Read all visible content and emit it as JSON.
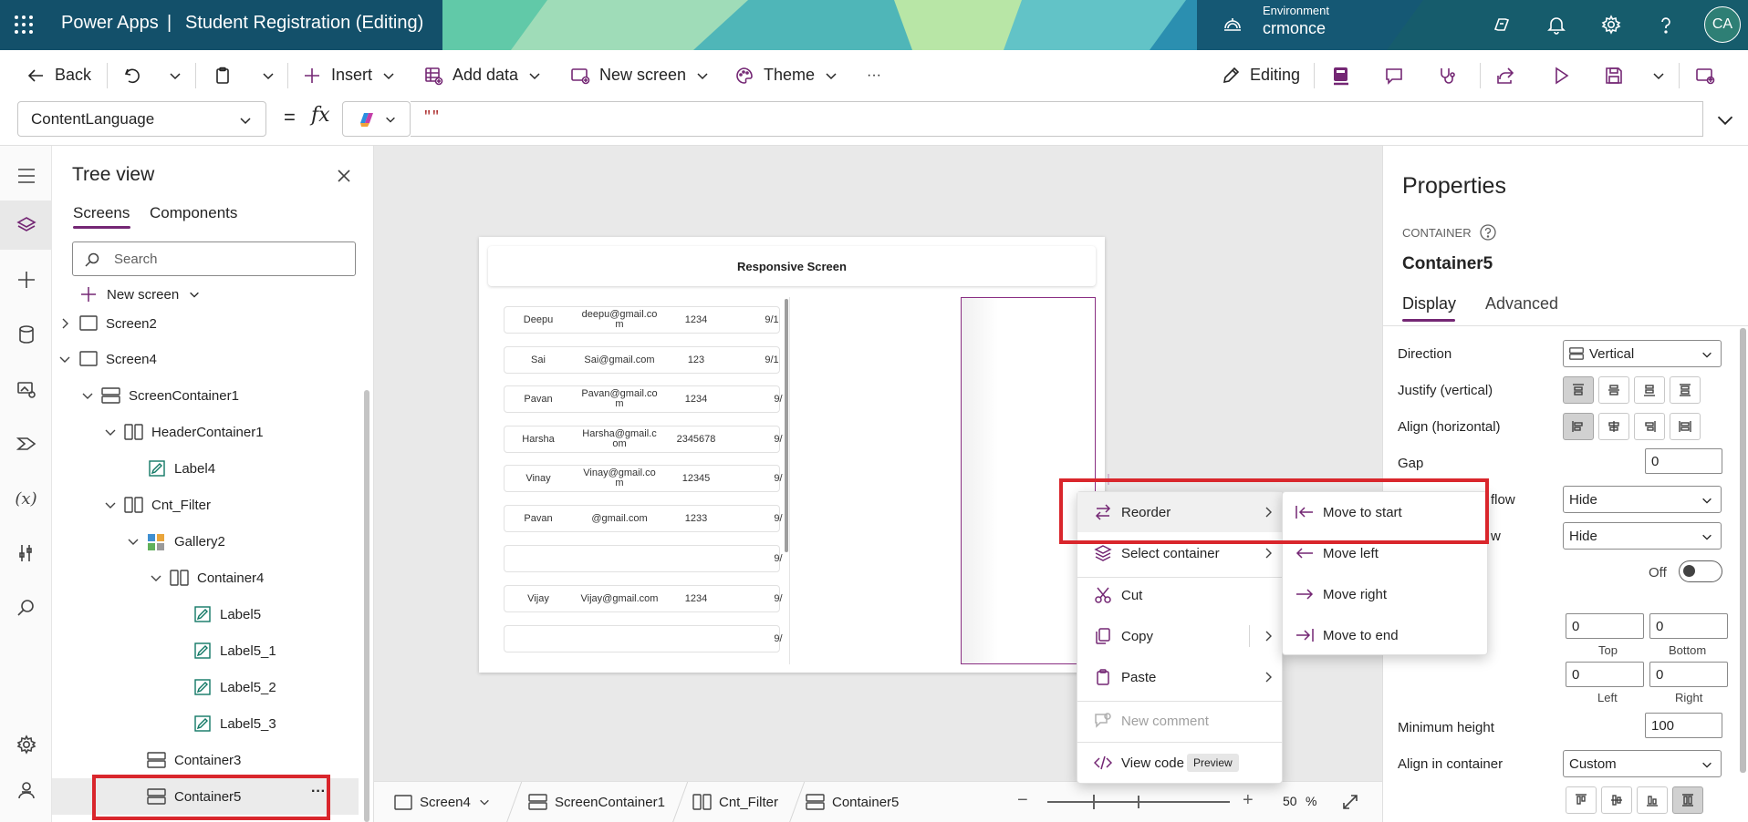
{
  "header": {
    "app_name": "Power Apps",
    "separator": "|",
    "app_title": "Student Registration (Editing)",
    "environment_label": "Environment",
    "environment_name": "crmonce",
    "avatar_initials": "CA"
  },
  "cmdbar": {
    "back": "Back",
    "insert": "Insert",
    "add_data": "Add data",
    "new_screen": "New screen",
    "theme": "Theme",
    "more": "···",
    "editing": "Editing"
  },
  "formula": {
    "property": "ContentLanguage",
    "equals": "=",
    "fx": "fx",
    "value": "\"\""
  },
  "tree": {
    "title": "Tree view",
    "tabs": [
      "Screens",
      "Components"
    ],
    "search_placeholder": "Search",
    "new_screen": "New screen",
    "items": [
      "Screen2",
      "Screen4",
      "ScreenContainer1",
      "HeaderContainer1",
      "Label4",
      "Cnt_Filter",
      "Gallery2",
      "Container4",
      "Label5",
      "Label5_1",
      "Label5_2",
      "Label5_3",
      "Container3",
      "Container5"
    ],
    "more": "···"
  },
  "canvas": {
    "header_title": "Responsive Screen",
    "rows": [
      {
        "name": "Deepu",
        "email": "deepu@gmail.co m",
        "phone": "1234",
        "date": "9/1"
      },
      {
        "name": "Sai",
        "email": "Sai@gmail.com",
        "phone": "123",
        "date": "9/1"
      },
      {
        "name": "Pavan",
        "email": "Pavan@gmail.co m",
        "phone": "1234",
        "date": "9/"
      },
      {
        "name": "Harsha",
        "email": "Harsha@gmail.c om",
        "phone": "2345678",
        "date": "9/"
      },
      {
        "name": "Vinay",
        "email": "Vinay@gmail.co m",
        "phone": "12345",
        "date": "9/"
      },
      {
        "name": "Pavan",
        "email": "@gmail.com",
        "phone": "1233",
        "date": "9/"
      },
      {
        "name": "",
        "email": "",
        "phone": "",
        "date": "9/"
      },
      {
        "name": "Vijay",
        "email": "Vijay@gmail.com",
        "phone": "1234",
        "date": "9/"
      },
      {
        "name": "",
        "email": "",
        "phone": "",
        "date": "9/"
      }
    ]
  },
  "context_menu": {
    "items": [
      "Reorder",
      "Select container",
      "Cut",
      "Copy",
      "Paste",
      "New comment",
      "View code"
    ],
    "preview_badge": "Preview"
  },
  "submenu": {
    "items": [
      "Move to start",
      "Move left",
      "Move right",
      "Move to end"
    ]
  },
  "bottombar": {
    "crumbs": [
      "Screen4",
      "ScreenContainer1",
      "Cnt_Filter",
      "Container5"
    ],
    "zoom_minus": "−",
    "zoom_plus": "+",
    "zoom_value": "50",
    "zoom_unit": "%"
  },
  "properties": {
    "title": "Properties",
    "type": "CONTAINER",
    "name": "Container5",
    "tabs": [
      "Display",
      "Advanced"
    ],
    "direction_label": "Direction",
    "direction_value": "Vertical",
    "justify_label": "Justify (vertical)",
    "align_label": "Align (horizontal)",
    "gap_label": "Gap",
    "gap_value": "0",
    "overflow_label_part": "flow",
    "overflow_value": "Hide",
    "overflow2_label_part": "w",
    "overflow2_value": "Hide",
    "toggle_value": "Off",
    "pad_top": "0",
    "pad_bottom": "0",
    "pad_left": "0",
    "pad_right": "0",
    "top_label": "Top",
    "bottom_label": "Bottom",
    "left_label": "Left",
    "right_label": "Right",
    "min_height_label": "Minimum height",
    "min_height_value": "100",
    "align_in_container_label": "Align in container",
    "align_in_container_value": "Custom"
  },
  "colors": {
    "accent": "#742774",
    "highlight": "#d9262c"
  }
}
